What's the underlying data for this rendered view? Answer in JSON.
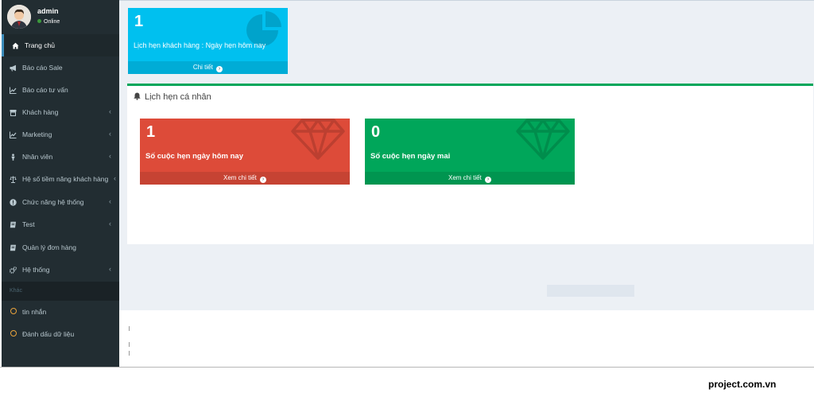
{
  "user": {
    "name": "admin",
    "status": "Online"
  },
  "sidebar": {
    "items": [
      {
        "label": "Trang chủ",
        "icon": "home-icon",
        "active": true,
        "chevron": false
      },
      {
        "label": "Báo cáo Sale",
        "icon": "bullhorn-icon",
        "chevron": false
      },
      {
        "label": "Báo cáo tư vấn",
        "icon": "line-chart-icon",
        "chevron": false
      },
      {
        "label": "Khách hàng",
        "icon": "store-icon",
        "chevron": true
      },
      {
        "label": "Marketing",
        "icon": "line-chart-icon",
        "chevron": true
      },
      {
        "label": "Nhân viên",
        "icon": "user-icon",
        "chevron": true
      },
      {
        "label": "Hệ số tiềm năng khách hàng",
        "icon": "balance-icon",
        "chevron": true
      },
      {
        "label": "Chức năng hệ thống",
        "icon": "info-circle-icon",
        "chevron": true
      },
      {
        "label": "Test",
        "icon": "book-icon",
        "chevron": true
      },
      {
        "label": "Quản lý đơn hàng",
        "icon": "book-icon",
        "chevron": false
      },
      {
        "label": "Hệ thống",
        "icon": "cogs-icon",
        "chevron": true
      }
    ],
    "section_header": "Khác",
    "extra_items": [
      {
        "label": "tin nhắn",
        "icon": "circle-outline-icon"
      },
      {
        "label": "Đánh dấu dữ liệu",
        "icon": "circle-outline-icon"
      }
    ],
    "chevron_char": "‹"
  },
  "stat_box": {
    "number": "1",
    "text": "Lịch hẹn khách hàng : Ngày hẹn hôm nay",
    "footer": "Chi tiết",
    "icon": "pie-chart-icon",
    "color": "#00c0ef"
  },
  "panel": {
    "title": "Lịch hẹn cá nhân",
    "accent": "#00a65a",
    "boxes": [
      {
        "number": "1",
        "text": "Số cuộc hẹn ngày hôm nay",
        "footer": "Xem chi tiết",
        "icon": "diamond-icon",
        "color": "#dd4b39"
      },
      {
        "number": "0",
        "text": "Số cuộc hẹn ngày mai",
        "footer": "Xem chi tiết",
        "icon": "diamond-icon",
        "color": "#00a65a"
      }
    ]
  },
  "watermark": "project.com.vn",
  "arrow_char": "›"
}
